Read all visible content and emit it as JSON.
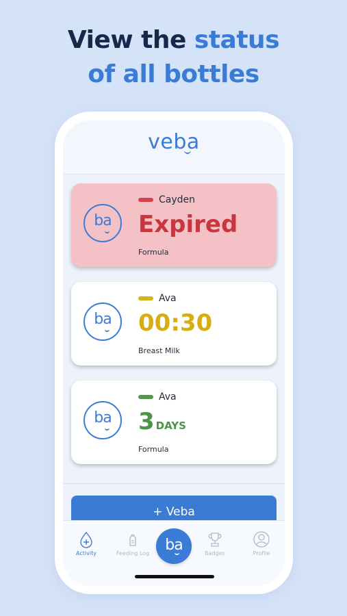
{
  "headline": {
    "line1_dark": "View the ",
    "line1_blue": "status",
    "line2": "of all bottles"
  },
  "app": {
    "logo": "veba"
  },
  "bottles": [
    {
      "name": "Cayden",
      "status": "Expired",
      "unit": "",
      "type": "Formula",
      "dash_color": "#d0434f",
      "status_color": "#c8363f",
      "card_bg": "#f3c1c6"
    },
    {
      "name": "Ava",
      "status": "00:30",
      "unit": "",
      "type": "Breast Milk",
      "dash_color": "#d8b21a",
      "status_color": "#d8ad12",
      "card_bg": "#ffffff"
    },
    {
      "name": "Ava",
      "status": "3",
      "unit": "DAYS",
      "type": "Formula",
      "dash_color": "#4f9a4a",
      "status_color": "#4a9545",
      "card_bg": "#ffffff"
    }
  ],
  "badge_glyph": "ba",
  "add_button": "+ Veba",
  "tabs": [
    {
      "label": "Activity",
      "icon": "drop-plus-icon",
      "active": true
    },
    {
      "label": "Feeding Log",
      "icon": "feeding-log-icon",
      "active": false
    },
    {
      "label": "Badges",
      "icon": "trophy-icon",
      "active": false
    },
    {
      "label": "Profile",
      "icon": "profile-icon",
      "active": false
    }
  ],
  "colors": {
    "brand_blue": "#3a7bd5",
    "background": "#d5e3f9",
    "headline_dark": "#17294a"
  }
}
